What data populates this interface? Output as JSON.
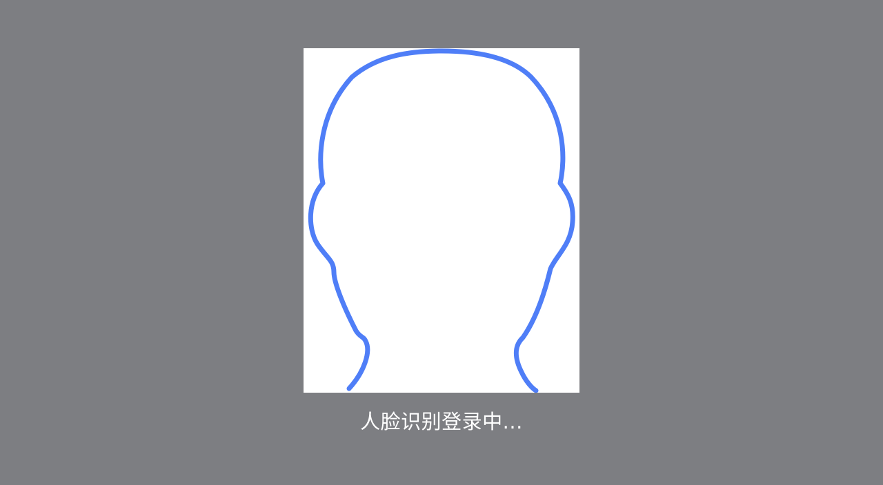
{
  "face_recognition": {
    "status_text": "人脸识别登录中...",
    "outline_icon": "head-silhouette-icon",
    "outline_color": "#4f7ef7",
    "frame_color": "#ffffff",
    "backdrop_color": "#7d7e82"
  }
}
